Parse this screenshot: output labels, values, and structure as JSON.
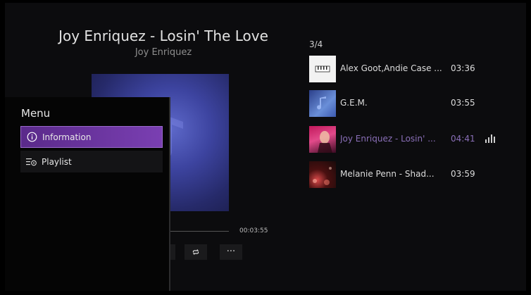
{
  "now_playing": {
    "title": "Joy Enriquez - Losin' The Love",
    "artist": "Joy Enriquez",
    "total_time": "00:03:55"
  },
  "controls": {
    "repeat_icon": "repeat-icon",
    "more_label": "···"
  },
  "menu": {
    "title": "Menu",
    "items": [
      {
        "label": "Information",
        "icon": "info-icon",
        "selected": true
      },
      {
        "label": "Playlist",
        "icon": "playlist-icon",
        "selected": false
      }
    ]
  },
  "playlist": {
    "position": "3/4",
    "tracks": [
      {
        "name": "Alex Goot,Andie Case ...",
        "duration": "03:36",
        "playing": false
      },
      {
        "name": "G.E.M.",
        "duration": "03:55",
        "playing": false
      },
      {
        "name": "Joy Enriquez - Losin' ...",
        "duration": "04:41",
        "playing": true
      },
      {
        "name": "Melanie Penn - Shad...",
        "duration": "03:59",
        "playing": false
      }
    ]
  },
  "colors": {
    "accent_purple": "#7a3fb2",
    "playing_text": "#8a6fb8",
    "background": "#0c0c0e"
  }
}
